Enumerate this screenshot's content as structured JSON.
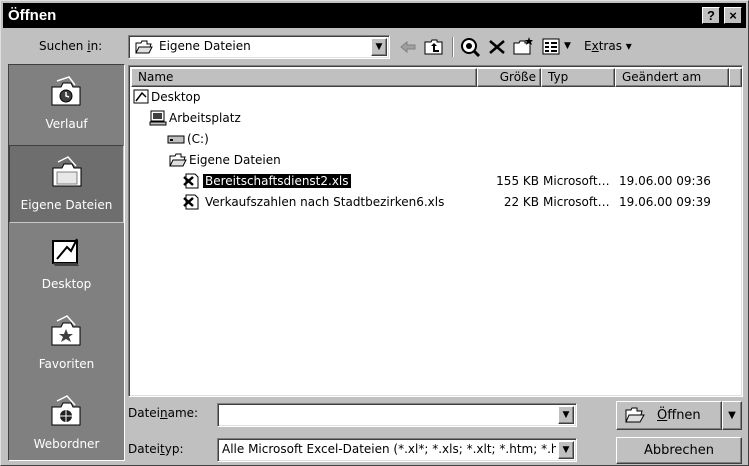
{
  "title": "Öffnen",
  "title_buttons": {
    "help": "?",
    "close": "×"
  },
  "toolbar": {
    "lookin_label_pre": "Suchen ",
    "lookin_label_key": "i",
    "lookin_label_post": "n:",
    "lookin_value": "Eigene Dateien",
    "extras_pre": "E",
    "extras_key": "x",
    "extras_post": "tras",
    "extras_arrow": "▾"
  },
  "places": [
    {
      "label": "Verlauf",
      "icon": "history-folder-icon"
    },
    {
      "label": "Eigene Dateien",
      "icon": "my-documents-folder-icon"
    },
    {
      "label": "Desktop",
      "icon": "desktop-icon"
    },
    {
      "label": "Favoriten",
      "icon": "favorites-folder-icon"
    },
    {
      "label": "Webordner",
      "icon": "web-folders-icon"
    }
  ],
  "columns": {
    "name": "Name",
    "size": "Größe",
    "type": "Typ",
    "modified": "Geändert am"
  },
  "tree": [
    {
      "name": "Desktop",
      "icon": "desktop-icon"
    },
    {
      "name": "Arbeitsplatz",
      "icon": "computer-icon"
    },
    {
      "name": "(C:)",
      "icon": "drive-icon"
    },
    {
      "name": "Eigene Dateien",
      "icon": "open-folder-icon"
    }
  ],
  "files": [
    {
      "name": "Bereitschaftsdienst2.xls",
      "size": "155 KB",
      "type": "Microsoft…",
      "modified": "19.06.00 09:36",
      "selected": true
    },
    {
      "name": "Verkaufszahlen nach Stadtbezirken6.xls",
      "size": "22 KB",
      "type": "Microsoft…",
      "modified": "19.06.00 09:39",
      "selected": false
    }
  ],
  "filename": {
    "label_pre": "Datei",
    "label_key": "n",
    "label_post": "ame:",
    "value": ""
  },
  "filetype": {
    "label_pre": "Datei",
    "label_key": "t",
    "label_post": "yp:",
    "value": "Alle Microsoft Excel-Dateien (*.xl*; *.xls; *.xlt; *.htm; *.ht"
  },
  "buttons": {
    "open_key": "Ö",
    "open_rest": "ffnen",
    "cancel": "Abbrechen"
  },
  "colors": {
    "title_bg": "#000000",
    "face": "#c0c0c0",
    "places_bg": "#808080",
    "selection": "#000000"
  }
}
